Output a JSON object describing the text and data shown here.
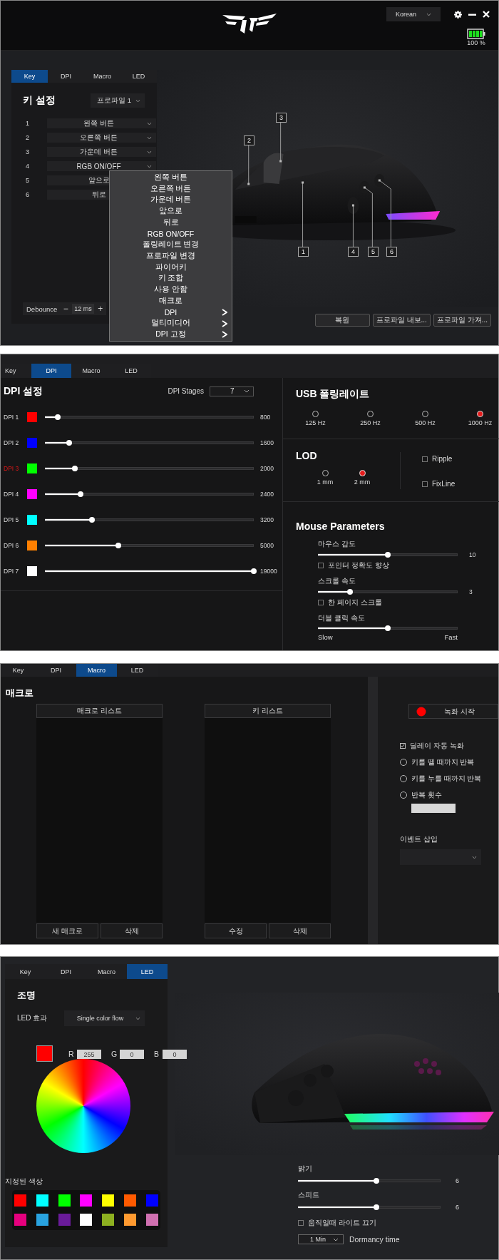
{
  "key_screen": {
    "language": "Korean",
    "battery_text": "100 %",
    "tabs": [
      {
        "label": "Key",
        "selected": true
      },
      {
        "label": "DPI",
        "selected": false
      },
      {
        "label": "Macro",
        "selected": false
      },
      {
        "label": "LED",
        "selected": false
      }
    ],
    "title": "키 설정",
    "profile": "프로파일 1",
    "key_rows": [
      {
        "number": "1",
        "value": "왼쪽 버튼"
      },
      {
        "number": "2",
        "value": "오른쪽 버튼"
      },
      {
        "number": "3",
        "value": "가운데 버튼"
      },
      {
        "number": "4",
        "value": "RGB ON/OFF"
      },
      {
        "number": "5",
        "value": "앞으로"
      },
      {
        "number": "6",
        "value": "뒤로"
      }
    ],
    "debounce": {
      "label": "Debounce",
      "minus": "−",
      "value": "12 ms",
      "plus": "+"
    },
    "menu": [
      {
        "label": "왼쪽 버튼",
        "submenu": false
      },
      {
        "label": "오른쪽 버튼",
        "submenu": false
      },
      {
        "label": "가운데 버튼",
        "submenu": false
      },
      {
        "label": "앞으로",
        "submenu": false
      },
      {
        "label": "뒤로",
        "submenu": false
      },
      {
        "label": "RGB ON/OFF",
        "submenu": false
      },
      {
        "label": "폴링레이트 변경",
        "submenu": false
      },
      {
        "label": "프로파일 변경",
        "submenu": false
      },
      {
        "label": "파이어키",
        "submenu": false
      },
      {
        "label": "키 조합",
        "submenu": false
      },
      {
        "label": "사용 안함",
        "submenu": false
      },
      {
        "label": "매크로",
        "submenu": false
      },
      {
        "label": "DPI",
        "submenu": true
      },
      {
        "label": "멀티미디어",
        "submenu": true
      },
      {
        "label": "DPI 고정",
        "submenu": true
      }
    ],
    "callouts": [
      "1",
      "2",
      "3",
      "4",
      "5",
      "6"
    ],
    "buttons": [
      "복원",
      "프로파일 내보...",
      "프로파일 가져..."
    ]
  },
  "dpi_screen": {
    "tabs": [
      {
        "label": "Key",
        "selected": false
      },
      {
        "label": "DPI",
        "selected": true
      },
      {
        "label": "Macro",
        "selected": false
      },
      {
        "label": "LED",
        "selected": false
      }
    ],
    "title": "DPI 설정",
    "stages_label": "DPI Stages",
    "stages_value": "7",
    "rows": [
      {
        "label": "DPI 1",
        "color": "#ff0000",
        "level": 0.06,
        "value": "800",
        "selected": false
      },
      {
        "label": "DPI 2",
        "color": "#0000ff",
        "level": 0.117,
        "value": "1600",
        "selected": false
      },
      {
        "label": "DPI 3",
        "color": "#00ff00",
        "level": 0.145,
        "value": "2000",
        "selected": true
      },
      {
        "label": "DPI 4",
        "color": "#ff00ff",
        "level": 0.17,
        "value": "2400",
        "selected": false
      },
      {
        "label": "DPI 5",
        "color": "#00ffff",
        "level": 0.225,
        "value": "3200",
        "selected": false
      },
      {
        "label": "DPI 6",
        "color": "#ff8000",
        "level": 0.35,
        "value": "5000",
        "selected": false
      },
      {
        "label": "DPI 7",
        "color": "#ffffff",
        "level": 1,
        "value": "19000",
        "selected": false
      }
    ],
    "polling": {
      "title": "USB 폴링레이트",
      "options": [
        {
          "label": "125 Hz",
          "selected": false
        },
        {
          "label": "250 Hz",
          "selected": false
        },
        {
          "label": "500 Hz",
          "selected": false
        },
        {
          "label": "1000 Hz",
          "selected": true
        }
      ]
    },
    "lod": {
      "title": "LOD",
      "options": [
        {
          "label": "1 mm",
          "selected": false
        },
        {
          "label": "2 mm",
          "selected": true
        }
      ],
      "checkboxes": [
        {
          "label": "Ripple",
          "checked": false
        },
        {
          "label": "FixLine",
          "checked": false
        }
      ]
    },
    "params": {
      "title": "Mouse Parameters",
      "items": [
        {
          "label": "마우스 감도",
          "level": 0.5,
          "reading": "10",
          "checkbox": {
            "label": "포인터 정확도 향상",
            "checked": false
          }
        },
        {
          "label": "스크롤 속도",
          "level": 0.23,
          "reading": "3",
          "checkbox": {
            "label": "한 페이지 스크롤",
            "checked": false
          }
        },
        {
          "label": "더블 클릭 속도",
          "level": 0.5,
          "min_label": "Slow",
          "max_label": "Fast"
        }
      ]
    }
  },
  "macro_screen": {
    "tabs": [
      {
        "label": "Key",
        "selected": false
      },
      {
        "label": "DPI",
        "selected": false
      },
      {
        "label": "Macro",
        "selected": true
      },
      {
        "label": "LED",
        "selected": false
      }
    ],
    "title": "매크로",
    "lists": [
      {
        "header": "매크로 리스트",
        "buttons": [
          "새 매크로",
          "삭제"
        ]
      },
      {
        "header": "키 리스트",
        "buttons": [
          "수정",
          "삭제"
        ]
      }
    ],
    "record": "녹화 시작",
    "options": [
      {
        "kind": "checkbox",
        "label": "딜레이 자동 녹화",
        "checked": true
      },
      {
        "kind": "radio",
        "label": "키를 뗄 때까지 반복",
        "selected": false
      },
      {
        "kind": "radio",
        "label": "키를 누를 때까지 반복",
        "selected": false
      },
      {
        "kind": "radio",
        "label": "반복 횟수",
        "selected": false,
        "count_field": true
      }
    ],
    "event_label": "이벤트 삽입"
  },
  "led_screen": {
    "tabs": [
      {
        "label": "Key",
        "selected": false
      },
      {
        "label": "DPI",
        "selected": false
      },
      {
        "label": "Macro",
        "selected": false
      },
      {
        "label": "LED",
        "selected": true
      }
    ],
    "title": "조명",
    "effect_label": "LED 효과",
    "effect": "Single color flow",
    "rgb": [
      {
        "label": "R",
        "value": "255"
      },
      {
        "label": "G",
        "value": "0"
      },
      {
        "label": "B",
        "value": "0"
      }
    ],
    "presets_title": "지정된 색상",
    "presets": [
      {
        "color": "#ff0000"
      },
      {
        "color": "#00ffff"
      },
      {
        "color": "#00ff00"
      },
      {
        "color": "#ff00ff"
      },
      {
        "color": "#ffff00"
      },
      {
        "color": "#ff5a00"
      },
      {
        "color": "#0000ff"
      },
      {
        "color": "#e6007e"
      },
      {
        "color": "#29a3e0"
      },
      {
        "color": "#6a1b9a"
      },
      {
        "color": "#ffffff"
      },
      {
        "color": "#8db020"
      },
      {
        "color": "#ff9a30"
      },
      {
        "color": "#d070b0"
      }
    ],
    "sliders": [
      {
        "label": "밝기",
        "level": 0.55,
        "reading": "6"
      },
      {
        "label": "스피드",
        "level": 0.55,
        "reading": "6"
      }
    ],
    "light_off": {
      "label": "움직일때 라이트 끄기",
      "checked": false
    },
    "dormancy": {
      "value": "1 Min",
      "label": "Dormancy time"
    }
  }
}
